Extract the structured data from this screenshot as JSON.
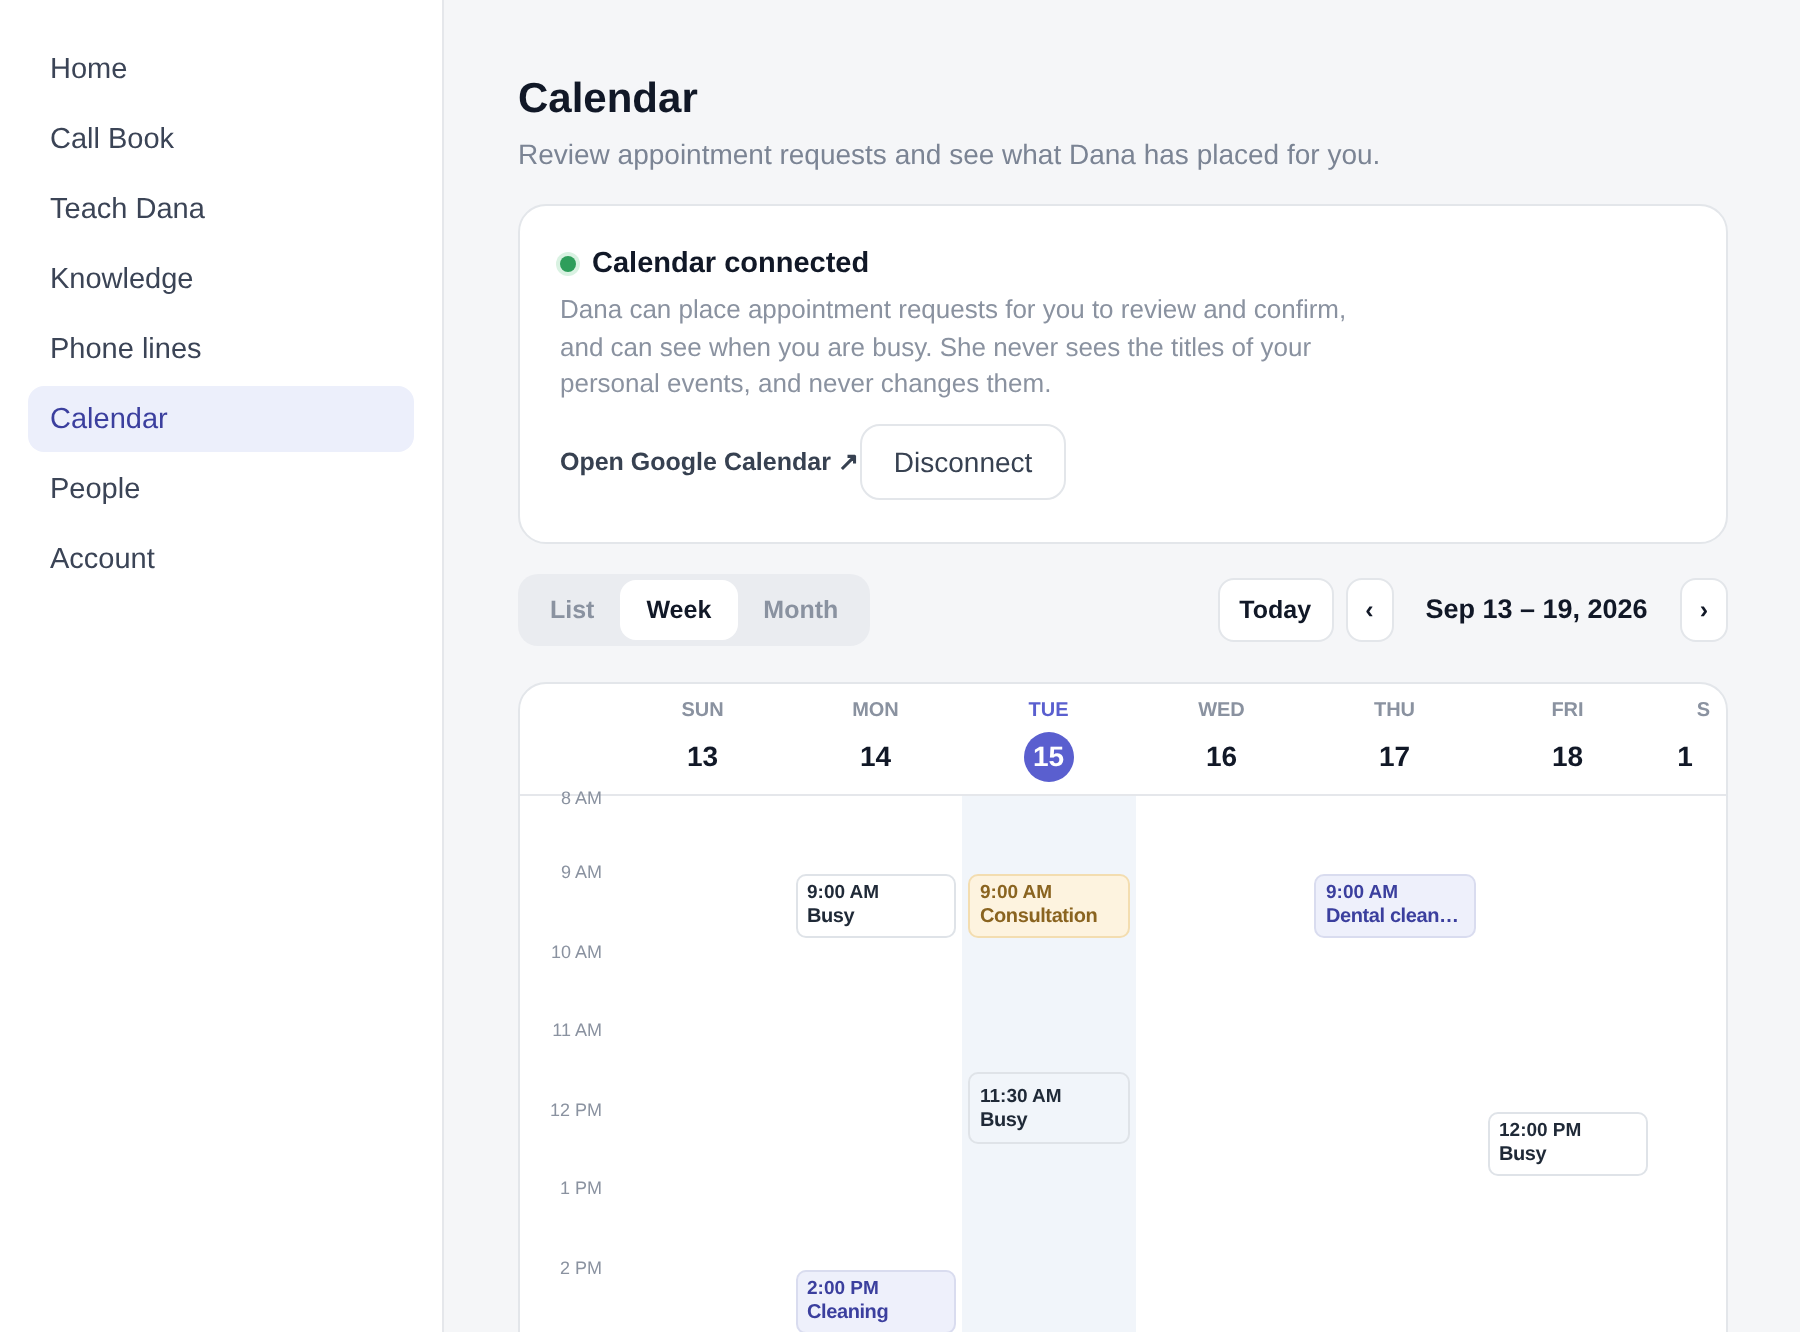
{
  "sidebar": {
    "items": [
      {
        "label": "Home",
        "selected": false
      },
      {
        "label": "Call Book",
        "selected": false
      },
      {
        "label": "Teach Dana",
        "selected": false
      },
      {
        "label": "Knowledge",
        "selected": false
      },
      {
        "label": "Phone lines",
        "selected": false
      },
      {
        "label": "Calendar",
        "selected": true
      },
      {
        "label": "People",
        "selected": false
      },
      {
        "label": "Account",
        "selected": false
      }
    ]
  },
  "header": {
    "title": "Calendar",
    "subtitle": "Review appointment requests and see what Dana has placed for you."
  },
  "connection": {
    "connected": true,
    "title": "Calendar connected",
    "description": "Dana can place appointment requests for you to review and confirm, and can see when you are busy. She never sees the titles of your personal events, and never changes them.",
    "link": "Open Google Calendar ↗",
    "button": "Disconnect"
  },
  "toolbar": {
    "views": [
      {
        "label": "List",
        "selected": false
      },
      {
        "label": "Week",
        "selected": true
      },
      {
        "label": "Month",
        "selected": false
      }
    ],
    "today": "Today",
    "prev": "‹",
    "range": "Sep 13 – 19, 2026",
    "next": "›"
  },
  "week": {
    "hours": [
      "8 AM",
      "9 AM",
      "10 AM",
      "11 AM",
      "12 PM",
      "1 PM",
      "2 PM"
    ],
    "days": [
      {
        "weekday": "SUN",
        "date": "13",
        "selected": false
      },
      {
        "weekday": "MON",
        "date": "14",
        "selected": false,
        "events": [
          {
            "kind": "busy",
            "time": "9:00 AM",
            "title": "Busy"
          },
          {
            "kind": "booked",
            "time": "2:00 PM",
            "title": "Cleaning"
          }
        ]
      },
      {
        "weekday": "TUE",
        "date": "15",
        "selected": true,
        "events": [
          {
            "kind": "request",
            "time": "9:00 AM",
            "title": "Consultation"
          },
          {
            "kind": "busy",
            "time": "11:30 AM",
            "title": "Busy"
          }
        ]
      },
      {
        "weekday": "WED",
        "date": "16",
        "selected": false
      },
      {
        "weekday": "THU",
        "date": "17",
        "selected": false,
        "events": [
          {
            "kind": "booked",
            "time": "9:00 AM",
            "title": "Dental clean…"
          }
        ]
      },
      {
        "weekday": "FRI",
        "date": "18",
        "selected": false,
        "events": [
          {
            "kind": "busy",
            "time": "12:00 PM",
            "title": "Busy"
          }
        ]
      },
      {
        "weekday": "S",
        "date": "1",
        "selected": false
      }
    ]
  }
}
